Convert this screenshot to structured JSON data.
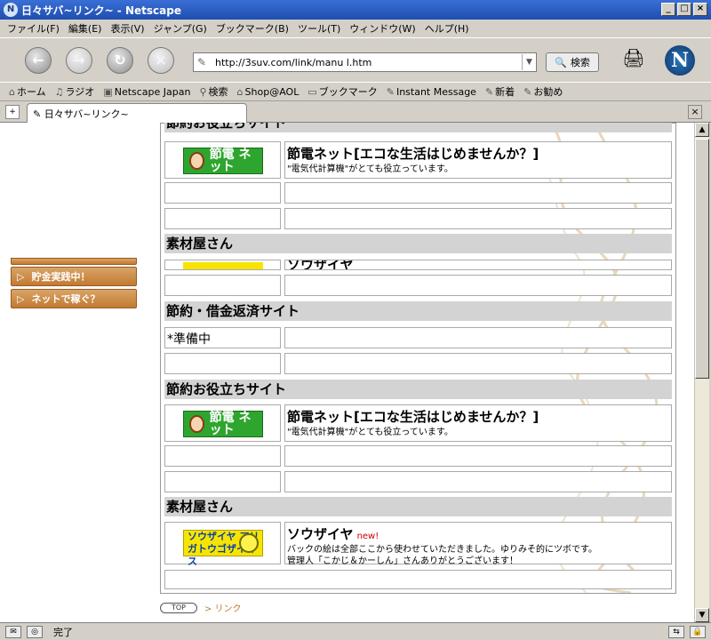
{
  "window": {
    "title": "日々サバ~リンク~ - Netscape",
    "controls": [
      "_",
      "□",
      "×"
    ]
  },
  "menu": [
    "ファイル(F)",
    "編集(E)",
    "表示(V)",
    "ジャンプ(G)",
    "ブックマーク(B)",
    "ツール(T)",
    "ウィンドウ(W)",
    "ヘルプ(H)"
  ],
  "navbar": {
    "url": "http://3suv.com/link/manu l.htm",
    "search_label": "検索"
  },
  "bookmarks": [
    "ホーム",
    "ラジオ",
    "Netscape Japan",
    "検索",
    "Shop@AOL",
    "ブックマーク",
    "Instant Message",
    "新着",
    "お勧め"
  ],
  "tab": {
    "title": "日々サバ~リンク~"
  },
  "sidebar": {
    "items": [
      "貯金実践中！",
      "ネットで稼ぐ？"
    ]
  },
  "sections": {
    "s1_partial": "節約お役立ちサイト",
    "s2": "素材屋さん",
    "s3": "節約・借金返済サイト",
    "s4": "節約お役立ちサイト",
    "s5": "素材屋さん"
  },
  "links": {
    "setsuden_title": "節電ネット[エコな生活はじめませんか？]",
    "setsuden_desc": "\"電気代計算機\"がとても役立っています。",
    "setsuden_img": "節電 ネット",
    "souzaiya_title": "ソウザイヤ",
    "souzaiya_new": "new!",
    "souzaiya_desc1": "バックの絵は全部ここから使わせていただきました。ゆりみそ的にツボです。",
    "souzaiya_desc2": "管理人「こかじ＆かーしん」さんありがとうございます！",
    "souzaiya_img": "ソウザイヤ アリガトウゴザイマス",
    "preparing": "*準備中",
    "souzaiya_partial": "ソウザイヤ"
  },
  "footer": {
    "top_label": "TOP",
    "crumb": "> リンク"
  },
  "status": {
    "text": "完了"
  },
  "colors": {
    "title_bar": "#1f4eb0",
    "sidebar_button": "#c27a32",
    "section_band": "#d3d3d3",
    "link_green": "#2ea52e",
    "link_yellow": "#f7e400"
  }
}
